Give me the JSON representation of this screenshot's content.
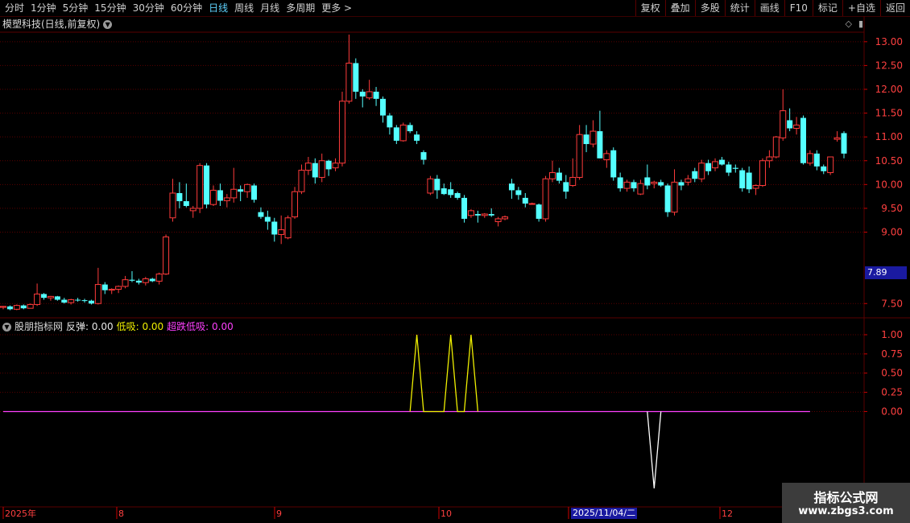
{
  "toolbar": {
    "periods": [
      "分时",
      "1分钟",
      "5分钟",
      "15分钟",
      "30分钟",
      "60分钟",
      "日线",
      "周线",
      "月线",
      "多周期",
      "更多 >"
    ],
    "active_period": "日线",
    "actions": [
      "复权",
      "叠加",
      "多股",
      "统计",
      "画线",
      "F10",
      "标记",
      "+自选",
      "返回"
    ]
  },
  "stock": {
    "title": "模塑科技(日线,前复权)"
  },
  "indicator": {
    "name": "股朋指标网",
    "label1": "反弹: 0.00",
    "label2": "低吸: 0.00",
    "label3": "超跌低吸: 0.00"
  },
  "current_price_tag": "7.89",
  "crosshair_date": "2025/11/04/二",
  "watermark": {
    "line1": "指标公式网",
    "line2": "www.zbgs3.com"
  },
  "colors": {
    "up": "#ff3b3b",
    "down": "#54ffff",
    "bg": "#000000",
    "grid": "#5a0000",
    "fanTan": "#ffffff",
    "diXi": "#f0f000",
    "chaoDie": "#ff40ff"
  },
  "chart_data": [
    {
      "type": "candlestick",
      "title": "模塑科技(日线,前复权)",
      "ylim": [
        7.2,
        13.2
      ],
      "yticks": [
        "13.00",
        "12.50",
        "12.00",
        "11.50",
        "11.00",
        "10.50",
        "10.00",
        "9.50",
        "9.00",
        "7.50"
      ],
      "x_labels": [
        "2025年",
        "8",
        "9",
        "10",
        "11",
        "12"
      ],
      "ohlc": [
        [
          7.42,
          7.45,
          7.38,
          7.44
        ],
        [
          7.44,
          7.46,
          7.36,
          7.38
        ],
        [
          7.38,
          7.48,
          7.36,
          7.46
        ],
        [
          7.46,
          7.48,
          7.38,
          7.4
        ],
        [
          7.4,
          7.5,
          7.4,
          7.48
        ],
        [
          7.48,
          7.92,
          7.45,
          7.7
        ],
        [
          7.7,
          7.72,
          7.58,
          7.62
        ],
        [
          7.62,
          7.66,
          7.56,
          7.65
        ],
        [
          7.65,
          7.66,
          7.56,
          7.58
        ],
        [
          7.58,
          7.62,
          7.5,
          7.52
        ],
        [
          7.52,
          7.6,
          7.48,
          7.58
        ],
        [
          7.58,
          7.62,
          7.54,
          7.57
        ],
        [
          7.57,
          7.6,
          7.52,
          7.56
        ],
        [
          7.56,
          7.58,
          7.48,
          7.5
        ],
        [
          7.5,
          8.25,
          7.48,
          7.9
        ],
        [
          7.9,
          7.95,
          7.7,
          7.78
        ],
        [
          7.78,
          7.82,
          7.7,
          7.8
        ],
        [
          7.8,
          7.88,
          7.72,
          7.86
        ],
        [
          7.86,
          8.08,
          7.82,
          8.0
        ],
        [
          8.0,
          8.18,
          7.95,
          7.98
        ],
        [
          7.98,
          8.02,
          7.9,
          7.94
        ],
        [
          7.94,
          8.06,
          7.88,
          8.02
        ],
        [
          8.02,
          8.04,
          7.95,
          7.97
        ],
        [
          7.97,
          8.15,
          7.9,
          8.12
        ],
        [
          8.12,
          8.95,
          8.1,
          8.9
        ],
        [
          9.3,
          10.12,
          9.22,
          9.82
        ],
        [
          9.82,
          10.05,
          9.5,
          9.65
        ],
        [
          9.65,
          10.02,
          9.52,
          9.55
        ],
        [
          9.45,
          9.55,
          9.3,
          9.5
        ],
        [
          9.5,
          10.45,
          9.4,
          10.4
        ],
        [
          10.4,
          10.45,
          9.5,
          9.58
        ],
        [
          9.58,
          9.98,
          9.55,
          9.88
        ],
        [
          9.88,
          10.02,
          9.55,
          9.66
        ],
        [
          9.66,
          9.8,
          9.52,
          9.72
        ],
        [
          9.72,
          10.35,
          9.62,
          9.9
        ],
        [
          9.9,
          9.98,
          9.65,
          9.85
        ],
        [
          9.85,
          10.02,
          9.72,
          10.0
        ],
        [
          9.98,
          10.02,
          9.62,
          9.68
        ],
        [
          9.42,
          9.52,
          9.28,
          9.32
        ],
        [
          9.32,
          9.45,
          9.05,
          9.22
        ],
        [
          9.22,
          9.3,
          8.8,
          8.95
        ],
        [
          8.95,
          9.35,
          8.75,
          9.05
        ],
        [
          8.88,
          9.35,
          8.85,
          9.3
        ],
        [
          9.32,
          9.95,
          9.28,
          9.85
        ],
        [
          9.85,
          10.42,
          9.8,
          10.3
        ],
        [
          10.3,
          10.58,
          10.2,
          10.45
        ],
        [
          10.45,
          10.55,
          10.02,
          10.15
        ],
        [
          10.15,
          10.65,
          10.05,
          10.5
        ],
        [
          10.5,
          10.52,
          10.18,
          10.32
        ],
        [
          10.35,
          10.55,
          10.28,
          10.45
        ],
        [
          10.45,
          11.95,
          10.38,
          11.75
        ],
        [
          11.75,
          13.15,
          11.7,
          12.55
        ],
        [
          12.55,
          12.65,
          11.8,
          11.95
        ],
        [
          11.95,
          12.0,
          11.62,
          11.85
        ],
        [
          11.82,
          12.2,
          11.78,
          11.95
        ],
        [
          11.95,
          12.05,
          11.65,
          11.8
        ],
        [
          11.8,
          11.85,
          11.3,
          11.45
        ],
        [
          11.45,
          11.5,
          11.05,
          11.2
        ],
        [
          11.2,
          11.25,
          10.85,
          10.92
        ],
        [
          10.92,
          11.3,
          10.9,
          11.25
        ],
        [
          11.25,
          11.3,
          11.08,
          11.12
        ],
        [
          11.05,
          11.12,
          10.85,
          10.92
        ],
        [
          10.68,
          10.72,
          10.42,
          10.52
        ],
        [
          9.82,
          10.18,
          9.78,
          10.12
        ],
        [
          10.12,
          10.2,
          9.7,
          9.88
        ],
        [
          9.92,
          10.02,
          9.78,
          9.8
        ],
        [
          9.9,
          10.05,
          9.72,
          9.78
        ],
        [
          9.82,
          9.85,
          9.68,
          9.72
        ],
        [
          9.72,
          9.78,
          9.2,
          9.28
        ],
        [
          9.35,
          9.48,
          9.3,
          9.45
        ],
        [
          9.38,
          9.45,
          9.2,
          9.35
        ],
        [
          9.35,
          9.4,
          9.3,
          9.38
        ],
        [
          9.38,
          9.5,
          9.32,
          9.35
        ],
        [
          9.22,
          9.32,
          9.12,
          9.28
        ],
        [
          9.28,
          9.35,
          9.25,
          9.32
        ],
        [
          10.02,
          10.12,
          9.7,
          9.88
        ],
        [
          9.88,
          9.95,
          9.68,
          9.78
        ],
        [
          9.72,
          9.82,
          9.52,
          9.6
        ],
        [
          9.6,
          9.62,
          9.58,
          9.6
        ],
        [
          9.58,
          9.6,
          9.22,
          9.28
        ],
        [
          9.28,
          10.18,
          9.22,
          10.12
        ],
        [
          10.12,
          10.5,
          10.05,
          10.25
        ],
        [
          10.25,
          10.35,
          10.02,
          10.08
        ],
        [
          10.05,
          10.2,
          9.7,
          9.85
        ],
        [
          9.98,
          10.55,
          9.95,
          10.15
        ],
        [
          10.15,
          11.25,
          10.1,
          11.05
        ],
        [
          11.05,
          11.25,
          10.68,
          10.85
        ],
        [
          10.85,
          11.35,
          10.78,
          11.12
        ],
        [
          11.12,
          11.55,
          10.55,
          10.55
        ],
        [
          10.52,
          10.72,
          10.35,
          10.65
        ],
        [
          10.72,
          10.78,
          10.08,
          10.15
        ],
        [
          10.15,
          10.25,
          9.85,
          9.92
        ],
        [
          9.92,
          10.1,
          9.85,
          10.05
        ],
        [
          10.05,
          10.1,
          9.85,
          9.92
        ],
        [
          9.8,
          10.1,
          9.78,
          10.02
        ],
        [
          10.15,
          10.42,
          9.9,
          9.98
        ],
        [
          10.02,
          10.08,
          9.92,
          10.05
        ],
        [
          10.05,
          10.1,
          9.95,
          9.98
        ],
        [
          9.98,
          10.02,
          9.32,
          9.42
        ],
        [
          9.42,
          10.32,
          9.35,
          10.05
        ],
        [
          10.05,
          10.1,
          9.88,
          9.98
        ],
        [
          10.05,
          10.2,
          9.98,
          10.12
        ],
        [
          10.28,
          10.35,
          10.05,
          10.12
        ],
        [
          10.12,
          10.52,
          10.05,
          10.45
        ],
        [
          10.45,
          10.52,
          10.2,
          10.28
        ],
        [
          10.35,
          10.55,
          10.28,
          10.48
        ],
        [
          10.52,
          10.58,
          10.4,
          10.42
        ],
        [
          10.42,
          10.48,
          10.18,
          10.25
        ],
        [
          10.35,
          10.42,
          10.25,
          10.33
        ],
        [
          10.3,
          10.35,
          9.85,
          9.92
        ],
        [
          10.25,
          10.38,
          9.82,
          9.9
        ],
        [
          9.92,
          10.0,
          9.78,
          9.98
        ],
        [
          9.98,
          10.55,
          9.95,
          10.5
        ],
        [
          10.5,
          10.72,
          10.35,
          10.58
        ],
        [
          10.58,
          11.02,
          10.55,
          11.0
        ],
        [
          10.98,
          12.0,
          10.92,
          11.55
        ],
        [
          11.35,
          11.6,
          11.12,
          11.18
        ],
        [
          11.18,
          11.42,
          11.05,
          11.25
        ],
        [
          11.4,
          11.45,
          10.42,
          10.45
        ],
        [
          10.45,
          10.72,
          10.4,
          10.65
        ],
        [
          10.65,
          10.72,
          10.3,
          10.38
        ],
        [
          10.38,
          10.42,
          10.22,
          10.28
        ],
        [
          10.25,
          10.55,
          10.2,
          10.58
        ],
        [
          10.95,
          11.12,
          10.9,
          10.98
        ],
        [
          11.08,
          11.12,
          10.55,
          10.65
        ]
      ]
    },
    {
      "type": "line",
      "title": "股朋指标网",
      "ylim": [
        -1.2,
        1.0
      ],
      "yticks": [
        "1.00",
        "0.75",
        "0.50",
        "0.25",
        "0.00"
      ],
      "series": [
        {
          "name": "反弹",
          "values": [
            [
              95,
              0
            ],
            [
              96,
              -1.0
            ],
            [
              97,
              0
            ]
          ]
        },
        {
          "name": "低吸",
          "values": [
            [
              60,
              0
            ],
            [
              61,
              1.0
            ],
            [
              62,
              0
            ],
            [
              65,
              0
            ],
            [
              66,
              1.0
            ],
            [
              67,
              0
            ],
            [
              68,
              0
            ],
            [
              69,
              1.0
            ],
            [
              70,
              0
            ]
          ]
        },
        {
          "name": "超跌低吸",
          "values": [
            [
              0,
              0
            ],
            [
              119,
              0
            ]
          ]
        }
      ]
    }
  ]
}
